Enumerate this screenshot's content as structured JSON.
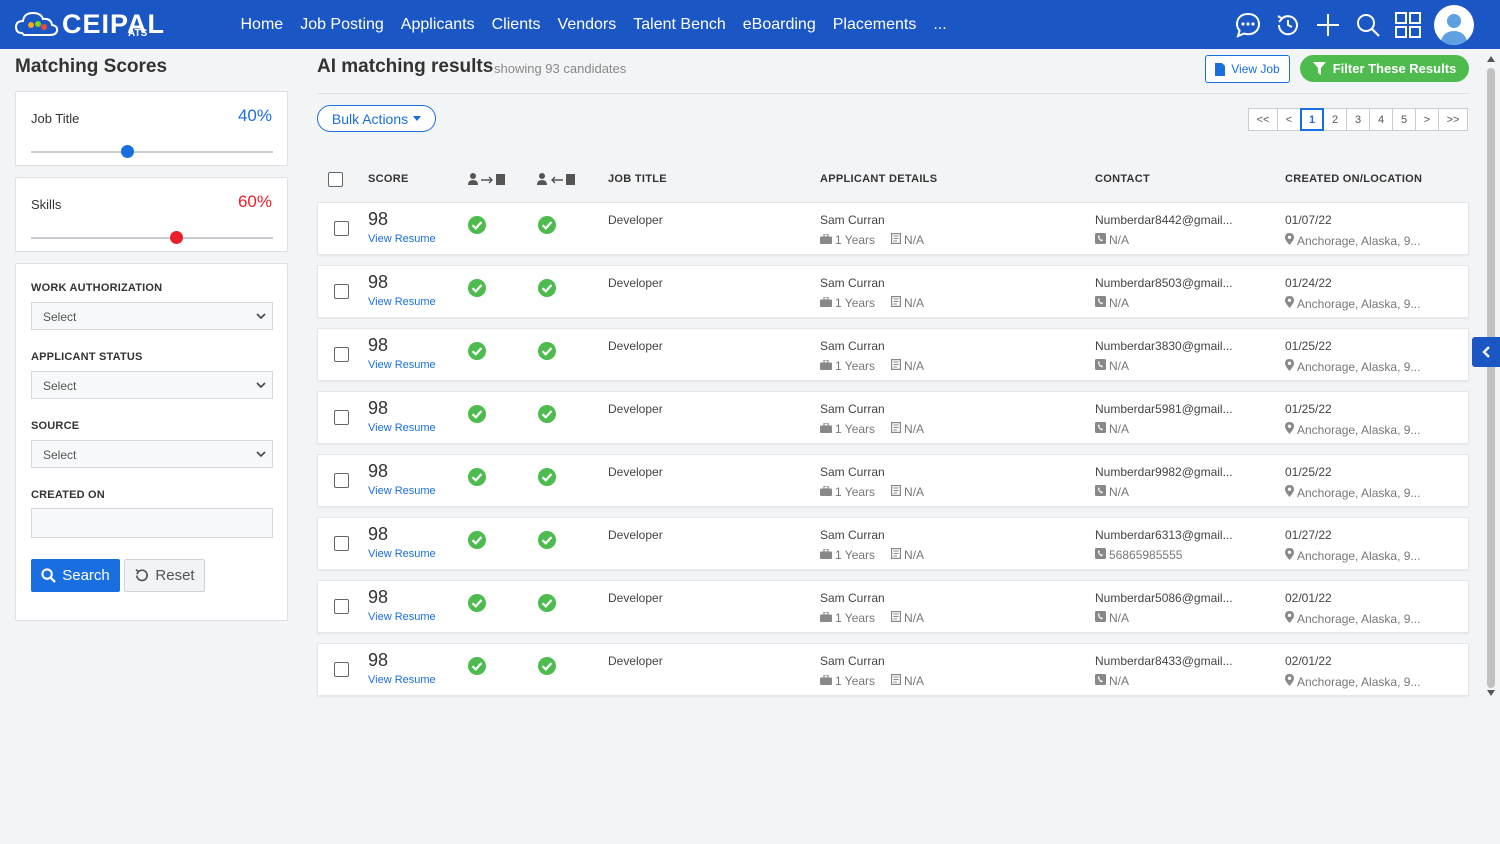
{
  "app": {
    "logo": "CEIPAL",
    "logo_sub": "ATS"
  },
  "nav": [
    "Home",
    "Job Posting",
    "Applicants",
    "Clients",
    "Vendors",
    "Talent Bench",
    "eBoarding",
    "Placements",
    "..."
  ],
  "top_icons": [
    "chat-icon",
    "history-icon",
    "plus-icon",
    "search-icon",
    "grid-icon",
    "avatar"
  ],
  "left": {
    "title": "Matching Scores",
    "job_title_label": "Job Title",
    "job_title_pct": "40%",
    "job_title_value": 0.4,
    "skills_label": "Skills",
    "skills_pct": "60%",
    "skills_value": 0.6,
    "work_auth_label": "WORK AUTHORIZATION",
    "work_auth_value": "Select",
    "status_label": "APPLICANT STATUS",
    "status_value": "Select",
    "source_label": "SOURCE",
    "source_value": "Select",
    "created_label": "CREATED ON",
    "created_value": "",
    "search_btn": "Search",
    "reset_btn": "Reset"
  },
  "main": {
    "title": "AI matching results",
    "subtitle": "showing 93 candidates",
    "view_job": "View Job",
    "filter_btn": "Filter These Results",
    "bulk_actions": "Bulk Actions",
    "pager": [
      "<<",
      "<",
      "1",
      "2",
      "3",
      "4",
      "5",
      ">",
      ">>"
    ],
    "pager_active": "1",
    "headers": {
      "score": "SCORE",
      "job_title": "JOB TITLE",
      "applicant": "APPLICANT DETAILS",
      "contact": "CONTACT",
      "created": "CREATED ON/LOCATION"
    },
    "rows": [
      {
        "score": "98",
        "resume": "View Resume",
        "title": "Developer",
        "name": "Sam Curran",
        "exp": "1 Years",
        "res": "N/A",
        "email": "Numberdar8442@gmail...",
        "phone": "N/A",
        "date": "01/07/22",
        "loc": "Anchorage, Alaska, 9..."
      },
      {
        "score": "98",
        "resume": "View Resume",
        "title": "Developer",
        "name": "Sam Curran",
        "exp": "1 Years",
        "res": "N/A",
        "email": "Numberdar8503@gmail...",
        "phone": "N/A",
        "date": "01/24/22",
        "loc": "Anchorage, Alaska, 9..."
      },
      {
        "score": "98",
        "resume": "View Resume",
        "title": "Developer",
        "name": "Sam Curran",
        "exp": "1 Years",
        "res": "N/A",
        "email": "Numberdar3830@gmail...",
        "phone": "N/A",
        "date": "01/25/22",
        "loc": "Anchorage, Alaska, 9..."
      },
      {
        "score": "98",
        "resume": "View Resume",
        "title": "Developer",
        "name": "Sam Curran",
        "exp": "1 Years",
        "res": "N/A",
        "email": "Numberdar5981@gmail...",
        "phone": "N/A",
        "date": "01/25/22",
        "loc": "Anchorage, Alaska, 9..."
      },
      {
        "score": "98",
        "resume": "View Resume",
        "title": "Developer",
        "name": "Sam Curran",
        "exp": "1 Years",
        "res": "N/A",
        "email": "Numberdar9982@gmail...",
        "phone": "N/A",
        "date": "01/25/22",
        "loc": "Anchorage, Alaska, 9..."
      },
      {
        "score": "98",
        "resume": "View Resume",
        "title": "Developer",
        "name": "Sam Curran",
        "exp": "1 Years",
        "res": "N/A",
        "email": "Numberdar6313@gmail...",
        "phone": "56865985555",
        "date": "01/27/22",
        "loc": "Anchorage, Alaska, 9..."
      },
      {
        "score": "98",
        "resume": "View Resume",
        "title": "Developer",
        "name": "Sam Curran",
        "exp": "1 Years",
        "res": "N/A",
        "email": "Numberdar5086@gmail...",
        "phone": "N/A",
        "date": "02/01/22",
        "loc": "Anchorage, Alaska, 9..."
      },
      {
        "score": "98",
        "resume": "View Resume",
        "title": "Developer",
        "name": "Sam Curran",
        "exp": "1 Years",
        "res": "N/A",
        "email": "Numberdar8433@gmail...",
        "phone": "N/A",
        "date": "02/01/22",
        "loc": "Anchorage, Alaska, 9..."
      }
    ]
  },
  "colors": {
    "brand": "#1a56c4",
    "accent": "#1a6fe0",
    "green": "#4dbb4d",
    "job_title_knob": "#1a6fe0",
    "skills_knob": "#e8202a"
  }
}
